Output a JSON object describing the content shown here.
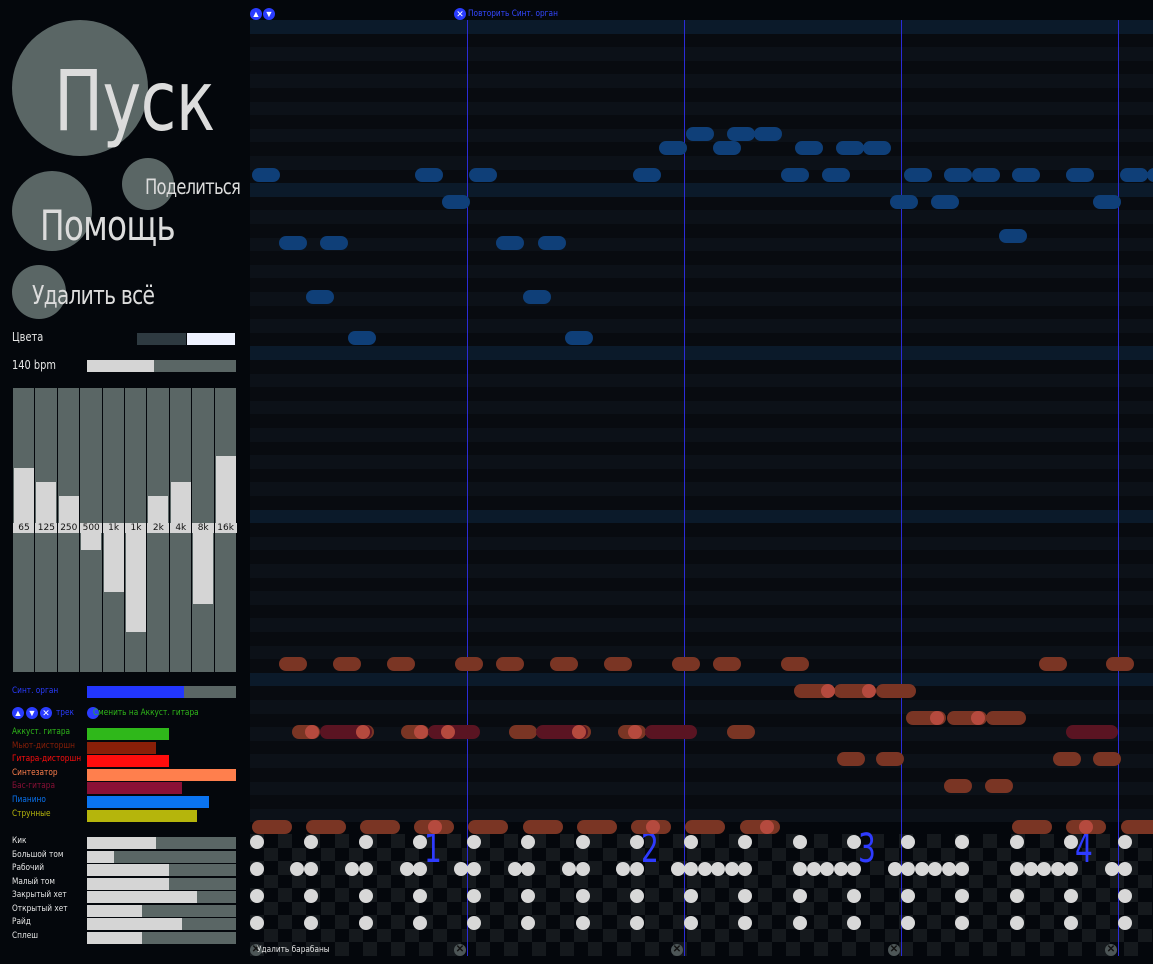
{
  "sidebar": {
    "play_label": "Пуск",
    "share_label": "Поделиться",
    "help_label": "Помощь",
    "clear_all_label": "Удалить всё",
    "colors_label": "Цвета",
    "tempo_label": "140 bpm",
    "tempo_value": 0.45,
    "eq_bands": [
      {
        "label": "65",
        "level": 0.72
      },
      {
        "label": "125",
        "level": 0.67
      },
      {
        "label": "250",
        "level": 0.62
      },
      {
        "label": "500",
        "level": 0.43
      },
      {
        "label": "1k",
        "level": 0.28
      },
      {
        "label": "1k",
        "level": 0.14
      },
      {
        "label": "2k",
        "level": 0.62
      },
      {
        "label": "4k",
        "level": 0.67
      },
      {
        "label": "8k",
        "level": 0.24
      },
      {
        "label": "16k",
        "level": 0.76
      }
    ],
    "active_track": {
      "label": "Синт. орган",
      "volume": 0.65,
      "color": "#2236ff"
    },
    "track_controls_label": "трек",
    "change_instrument_label": "Сменить на Аккуст. гитара",
    "instruments": [
      {
        "label": "Аккуст. гитара",
        "color": "#2fb81a",
        "level": 0.55
      },
      {
        "label": "Мьют-дисторшн",
        "color": "#8a1f08",
        "level": 0.46
      },
      {
        "label": "Гитара-дисторшн",
        "color": "#ff0d0d",
        "level": 0.55
      },
      {
        "label": "Синтезатор",
        "color": "#ff7f4d",
        "level": 1.0
      },
      {
        "label": "Бас-гитара",
        "color": "#8a1036",
        "level": 0.64
      },
      {
        "label": "Пианино",
        "color": "#0a74f2",
        "level": 0.82
      },
      {
        "label": "Струнные",
        "color": "#b5b50c",
        "level": 0.74
      }
    ],
    "drums": [
      {
        "label": "Кик",
        "level": 0.46
      },
      {
        "label": "Большой том",
        "level": 0.18
      },
      {
        "label": "Рабочий",
        "level": 0.55
      },
      {
        "label": "Малый том",
        "level": 0.55
      },
      {
        "label": "Закрытый хет",
        "level": 0.74
      },
      {
        "label": "Открытый хет",
        "level": 0.37
      },
      {
        "label": "Райд",
        "level": 0.64
      },
      {
        "label": "Сплеш",
        "level": 0.37
      }
    ]
  },
  "grid": {
    "repeat_label": "Повторить Синт. орган",
    "delete_drums_label": "Удалить барабаны",
    "beat_numbers": [
      "1",
      "2",
      "3",
      "4"
    ],
    "colors": {
      "organ": "#0f3f78",
      "orange": "#7a3524",
      "mutedist": "#5a1422",
      "accent": "#b54a3e"
    }
  }
}
